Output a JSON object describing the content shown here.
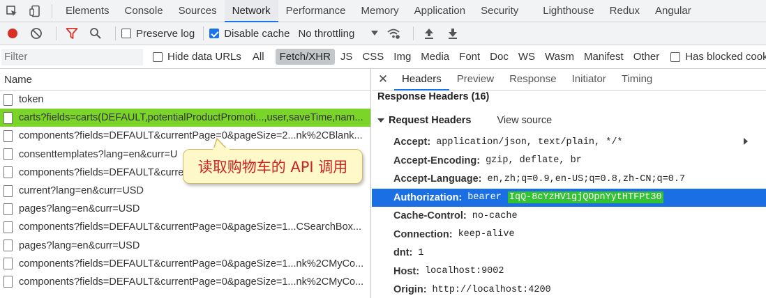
{
  "devtools_tabs": [
    "Elements",
    "Console",
    "Sources",
    "Network",
    "Performance",
    "Memory",
    "Application",
    "Security",
    "Lighthouse",
    "Redux",
    "Angular"
  ],
  "active_tab": "Network",
  "network_toolbar": {
    "preserve_log": "Preserve log",
    "disable_cache": "Disable cache",
    "throttling": "No throttling"
  },
  "filter_bar": {
    "placeholder": "Filter",
    "hide_data_urls": "Hide data URLs",
    "types": [
      "All",
      "Fetch/XHR",
      "JS",
      "CSS",
      "Img",
      "Media",
      "Font",
      "Doc",
      "WS",
      "Wasm",
      "Manifest",
      "Other"
    ],
    "active_type": "Fetch/XHR",
    "has_blocked_cookies": "Has blocked cookies"
  },
  "request_list": {
    "header": "Name",
    "rows": [
      "token",
      "carts?fields=carts(DEFAULT,potentialProductPromoti...,user,saveTime,nam...",
      "components?fields=DEFAULT&currentPage=0&pageSize=2...nk%2CBlank...",
      "consenttemplates?lang=en&curr=U",
      "components?fields=DEFAULT&curre",
      "current?lang=en&curr=USD",
      "pages?lang=en&curr=USD",
      "components?fields=DEFAULT&currentPage=0&pageSize=1...CSearchBox...",
      "pages?lang=en&curr=USD",
      "components?fields=DEFAULT&currentPage=0&pageSize=1...nk%2CMyCo...",
      "components?fields=DEFAULT&currentPage=0&pageSize=1...nk%2CMyCo..."
    ],
    "highlight_color": "#7bd428"
  },
  "callout": {
    "text": "读取购物车的 API 调用"
  },
  "details_panel": {
    "close": "✕",
    "tabs": [
      "Headers",
      "Preview",
      "Response",
      "Initiator",
      "Timing"
    ],
    "active_tab": "Headers",
    "response_headers": "Response Headers (16)",
    "request_headers": "Request Headers",
    "view_source": "View source",
    "headers": [
      {
        "key": "Accept:",
        "value": "application/json, text/plain, */*"
      },
      {
        "key": "Accept-Encoding:",
        "value": "gzip, deflate, br"
      },
      {
        "key": "Accept-Language:",
        "value": "en,zh;q=0.9,en-US;q=0.8,zh-CN;q=0.7"
      },
      {
        "key": "Authorization:",
        "value": "bearer",
        "token": "IqQ-8cYzHV1gjQOpnYytHTFPt30"
      },
      {
        "key": "Cache-Control:",
        "value": "no-cache"
      },
      {
        "key": "Connection:",
        "value": "keep-alive"
      },
      {
        "key": "dnt:",
        "value": "1"
      },
      {
        "key": "Host:",
        "value": "localhost:9002"
      },
      {
        "key": "Origin:",
        "value": "http://localhost:4200"
      }
    ],
    "highlight_color": "#1a6fe5"
  },
  "colors": {
    "record": "#d93025",
    "filter_funnel": "#d93025",
    "accent": "#1a73e8"
  }
}
